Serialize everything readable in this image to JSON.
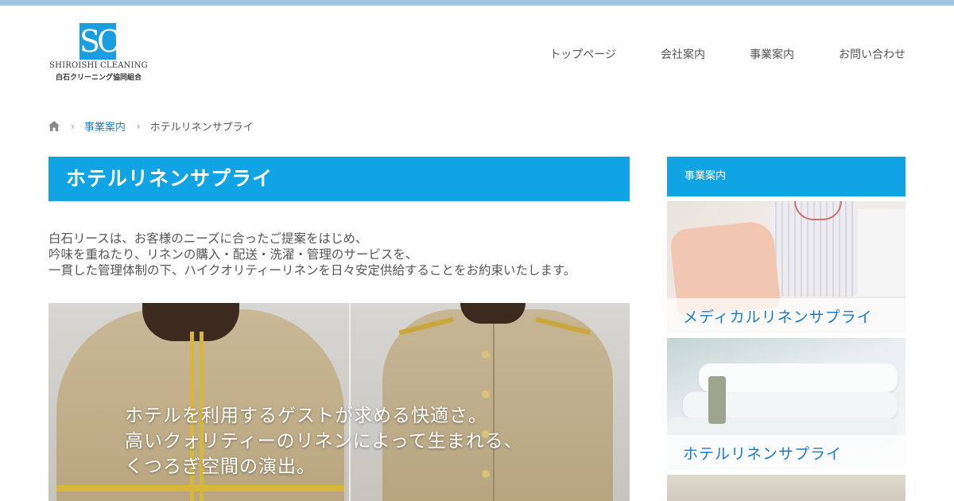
{
  "logo": {
    "mark": "SC",
    "name_en": "SHIROISHI CLEANING",
    "name_ja": "白石クリーニング協同組合"
  },
  "nav": {
    "items": [
      {
        "label": "トップページ"
      },
      {
        "label": "会社案内"
      },
      {
        "label": "事業案内"
      },
      {
        "label": "お問い合わせ"
      }
    ]
  },
  "breadcrumb": {
    "home_icon": "home-icon",
    "parent": "事業案内",
    "current": "ホテルリネンサプライ"
  },
  "main": {
    "title": "ホテルリネンサプライ",
    "intro": [
      "白石リースは、お客様のニーズに合ったご提案をはじめ、",
      "吟味を重ねたり、リネンの購入・配送・洗濯・管理のサービスを、",
      "一貫した管理体制の下、ハイクオリティーリネンを日々安定供給することをお約束いたします。"
    ],
    "hero_text": [
      "ホテルを利用するゲストが求める快適さ。",
      "高いクォリティーのリネンによって生まれる、",
      "くつろぎ空間の演出。"
    ]
  },
  "sidebar": {
    "heading": "事業案内",
    "cards": [
      {
        "label": "メディカルリネンサプライ"
      },
      {
        "label": "ホテルリネンサプライ"
      }
    ]
  },
  "colors": {
    "accent": "#11a4e4",
    "link": "#1a7cc9",
    "topbar": "#9fc5dd"
  }
}
